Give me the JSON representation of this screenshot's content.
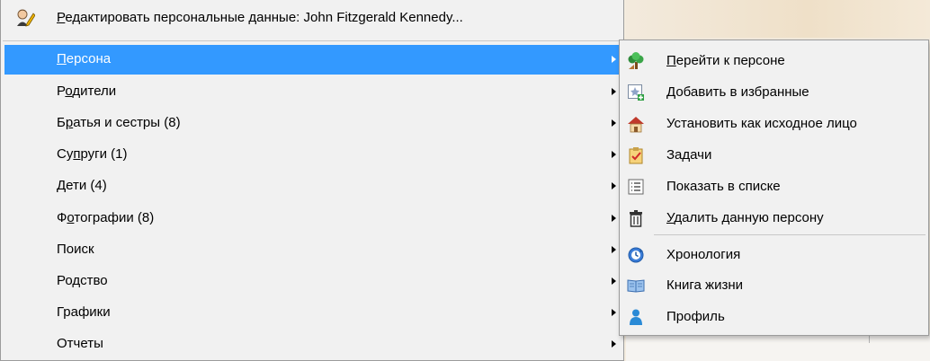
{
  "main_menu": {
    "header": {
      "prefix": "Р",
      "rest": "едактировать персональные данные: John Fitzgerald Kennedy..."
    },
    "items": [
      {
        "pre": "",
        "ul": "П",
        "post": "ерсона"
      },
      {
        "pre": "Р",
        "ul": "о",
        "post": "дители"
      },
      {
        "pre": "Б",
        "ul": "р",
        "post": "атья и сестры (8)"
      },
      {
        "pre": "Су",
        "ul": "п",
        "post": "руги (1)"
      },
      {
        "pre": "Дети (4)",
        "ul": "",
        "post": ""
      },
      {
        "pre": "Ф",
        "ul": "о",
        "post": "тографии (8)"
      },
      {
        "pre": "Поиск",
        "ul": "",
        "post": ""
      },
      {
        "pre": "Родство",
        "ul": "",
        "post": ""
      },
      {
        "pre": "Графики",
        "ul": "",
        "post": ""
      },
      {
        "pre": "Отчеты",
        "ul": "",
        "post": ""
      }
    ]
  },
  "sub_menu": {
    "items": [
      {
        "icon": "tree-icon",
        "pre": "",
        "ul": "П",
        "post": "ерейти к персоне"
      },
      {
        "icon": "add-favorite-icon",
        "pre": "Добавить в избранные",
        "ul": "",
        "post": ""
      },
      {
        "icon": "home-icon",
        "pre": "Установить как исходное лицо",
        "ul": "",
        "post": ""
      },
      {
        "icon": "tasks-icon",
        "pre": "Задачи",
        "ul": "",
        "post": ""
      },
      {
        "icon": "list-icon",
        "pre": "Показать в списке",
        "ul": "",
        "post": ""
      },
      {
        "icon": "trash-icon",
        "pre": "",
        "ul": "У",
        "post": "далить данную персону"
      },
      {
        "icon": "timeline-icon",
        "pre": "Хронология",
        "ul": "",
        "post": ""
      },
      {
        "icon": "book-icon",
        "pre": "Книга жизни",
        "ul": "",
        "post": ""
      },
      {
        "icon": "person-icon",
        "pre": "Профиль",
        "ul": "",
        "post": ""
      }
    ]
  },
  "colors": {
    "selection": "#3399ff",
    "menu_bg": "#f1f1f1"
  }
}
